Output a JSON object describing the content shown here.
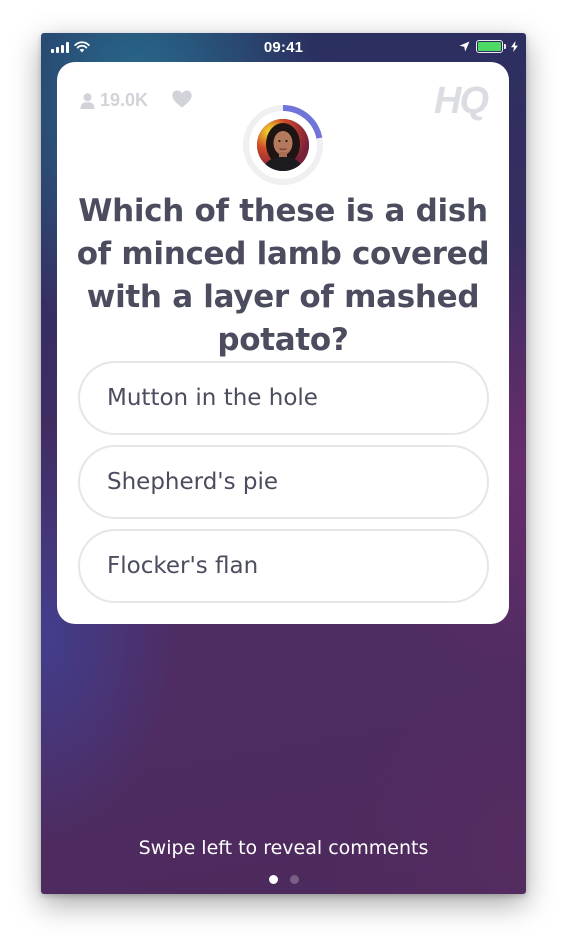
{
  "status_bar": {
    "time": "09:41"
  },
  "header": {
    "viewer_count": "19.0K",
    "logo": "HQ",
    "timer_progress": 0.22
  },
  "question": {
    "text": "Which of these is a dish of minced lamb covered with a layer of mashed potato?"
  },
  "answers": [
    {
      "label": "Mutton in the hole"
    },
    {
      "label": "Shepherd's pie"
    },
    {
      "label": "Flocker's flan"
    }
  ],
  "footer": {
    "hint": "Swipe left to reveal comments",
    "page_count": 2,
    "active_page": 0
  },
  "colors": {
    "timer_ring": "#6f74d8",
    "text_dark": "#4b4d5e",
    "muted": "#d2d3da",
    "battery": "#4cd964"
  }
}
